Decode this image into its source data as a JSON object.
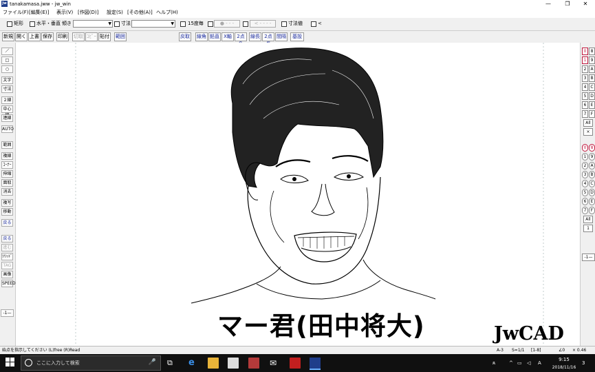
{
  "window": {
    "icon_text": "Jw",
    "title": "tanakamasa.jww - jw_win",
    "minimize_icon": "minimize-icon",
    "maximize_icon": "restore-icon",
    "close_icon": "close-icon"
  },
  "menu": [
    "ファイル(F)",
    "[編集(E)]",
    "表示(V)",
    "[作図(D)]",
    "設定(S)",
    "[その他(A)]",
    "ヘルプ(H)"
  ],
  "controls": {
    "rect_label": "矩形",
    "hv_label": "水平・垂直",
    "slope_label": "傾き",
    "dim_label": "寸法",
    "deg15_label": "15度毎",
    "disabled_1": "● - - -",
    "disabled_2": "< - - - -",
    "dimvalue_label": "寸法値",
    "lt_label": "<"
  },
  "toolbar": {
    "left": [
      "新規",
      "開く",
      "上書",
      "保存",
      "印刷",
      "切取",
      "ｺﾋﾟｰ",
      "貼付",
      "範囲"
    ],
    "right": [
      "線角",
      "鉛直",
      "X軸",
      "2点角",
      "線長",
      "2点長",
      "間隔",
      "基設"
    ],
    "mid": "戻取"
  },
  "left_tools": [
    "／",
    "□",
    "○",
    "文字",
    "寸法",
    "２線",
    "中心線",
    "連線",
    "AUTO",
    "範囲",
    "複線",
    "ｺｰﾅｰ",
    "伸縮",
    "面取",
    "消去",
    "複写",
    "移動",
    "戻る",
    "戻る",
    "進む",
    "ｿﾘｯﾄﾞ",
    "TAG",
    "画像",
    "SPEED",
    "-1—"
  ],
  "right_panel": {
    "layers_left": [
      "0",
      "1",
      "2",
      "3",
      "4",
      "5",
      "6",
      "7"
    ],
    "layers_right": [
      "8",
      "9",
      "A",
      "B",
      "C",
      "D",
      "E",
      "F"
    ],
    "all": "All",
    "x": "×",
    "groups_left": [
      "0",
      "1",
      "2",
      "3",
      "4",
      "5",
      "6",
      "7"
    ],
    "groups_right": [
      "8",
      "9",
      "A",
      "B",
      "C",
      "D",
      "E",
      "F"
    ],
    "all2": "All",
    "one": "1",
    "scale": "-1—"
  },
  "canvas": {
    "caption": "マー君(田中将大)",
    "brand": "JwCAD で作図"
  },
  "status": {
    "message": "始点を指示してください (L)free (R)Read",
    "paper": "A-3",
    "scale": "S=1/1",
    "layer": "[1-8]",
    "angle": "∠0",
    "zoom": "× 0.46"
  },
  "taskbar": {
    "search_placeholder": "ここに入力して検索",
    "time": "9:15",
    "date": "2018/11/16",
    "ime": "A",
    "badge": "3"
  }
}
